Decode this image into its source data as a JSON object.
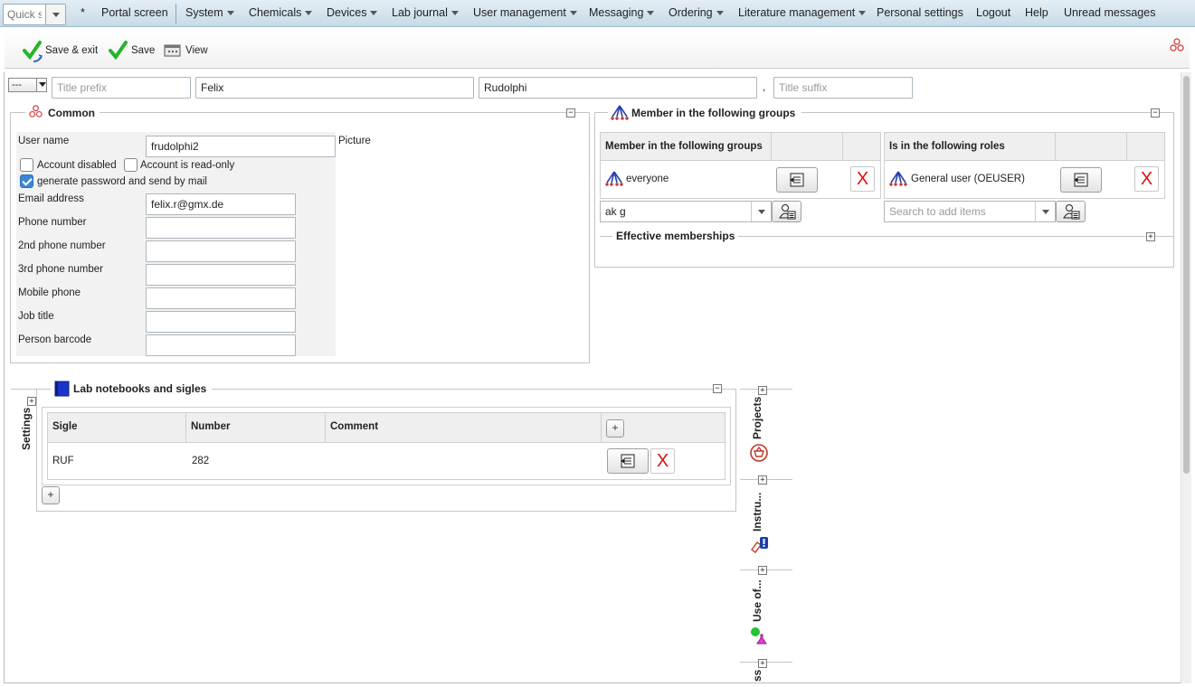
{
  "menubar": {
    "quick_search_placeholder": "Quick s",
    "star": "*",
    "items": [
      {
        "label": "Portal screen",
        "dropdown": false
      },
      {
        "label": "System",
        "dropdown": true
      },
      {
        "label": "Chemicals",
        "dropdown": true
      },
      {
        "label": "Devices",
        "dropdown": true
      },
      {
        "label": "Lab journal",
        "dropdown": true
      },
      {
        "label": "User management",
        "dropdown": true
      },
      {
        "label": "Messaging",
        "dropdown": true
      },
      {
        "label": "Ordering",
        "dropdown": true
      },
      {
        "label": "Literature management",
        "dropdown": true
      },
      {
        "label": "Personal settings",
        "dropdown": false
      },
      {
        "label": "Logout",
        "dropdown": false
      },
      {
        "label": "Help",
        "dropdown": false
      },
      {
        "label": "Unread messages",
        "dropdown": false
      }
    ]
  },
  "toolbar": {
    "save_exit_label": "Save & exit",
    "save_label": "Save",
    "view_label": "View"
  },
  "name_row": {
    "salutation": "---",
    "title_prefix_placeholder": "Title prefix",
    "first_name": "Felix",
    "last_name": "Rudolphi",
    "comma": ",",
    "title_suffix_placeholder": "Title suffix"
  },
  "common": {
    "legend": "Common",
    "picture_label": "Picture",
    "user_name_label": "User name",
    "user_name": "frudolphi2",
    "account_disabled_label": "Account disabled",
    "account_disabled": false,
    "read_only_label": "Account is read-only",
    "read_only": false,
    "gen_password_label": "generate password and send by mail",
    "gen_password": true,
    "email_label": "Email address",
    "email": "felix.r@gmx.de",
    "phone_label": "Phone number",
    "phone2_label": "2nd phone number",
    "phone3_label": "3rd phone number",
    "mobile_label": "Mobile phone",
    "job_title_label": "Job title",
    "barcode_label": "Person barcode"
  },
  "groups": {
    "legend": "Member in the following groups",
    "groups_header": "Member in the following groups",
    "group_rows": [
      "everyone"
    ],
    "group_search_value": "ak g",
    "roles_header": "Is in the following roles",
    "role_rows": [
      "General user (OEUSER)"
    ],
    "role_search_placeholder": "Search to add items",
    "effective_legend": "Effective memberships"
  },
  "notebooks": {
    "legend": "Lab notebooks and sigles",
    "settings_label": "Settings",
    "columns": [
      "Sigle",
      "Number",
      "Comment"
    ],
    "rows": [
      {
        "sigle": "RUF",
        "number": "282",
        "comment": ""
      }
    ],
    "add_label": "+"
  },
  "side_tabs": [
    "Projects",
    "Instru...",
    "Use of...",
    "ss"
  ]
}
